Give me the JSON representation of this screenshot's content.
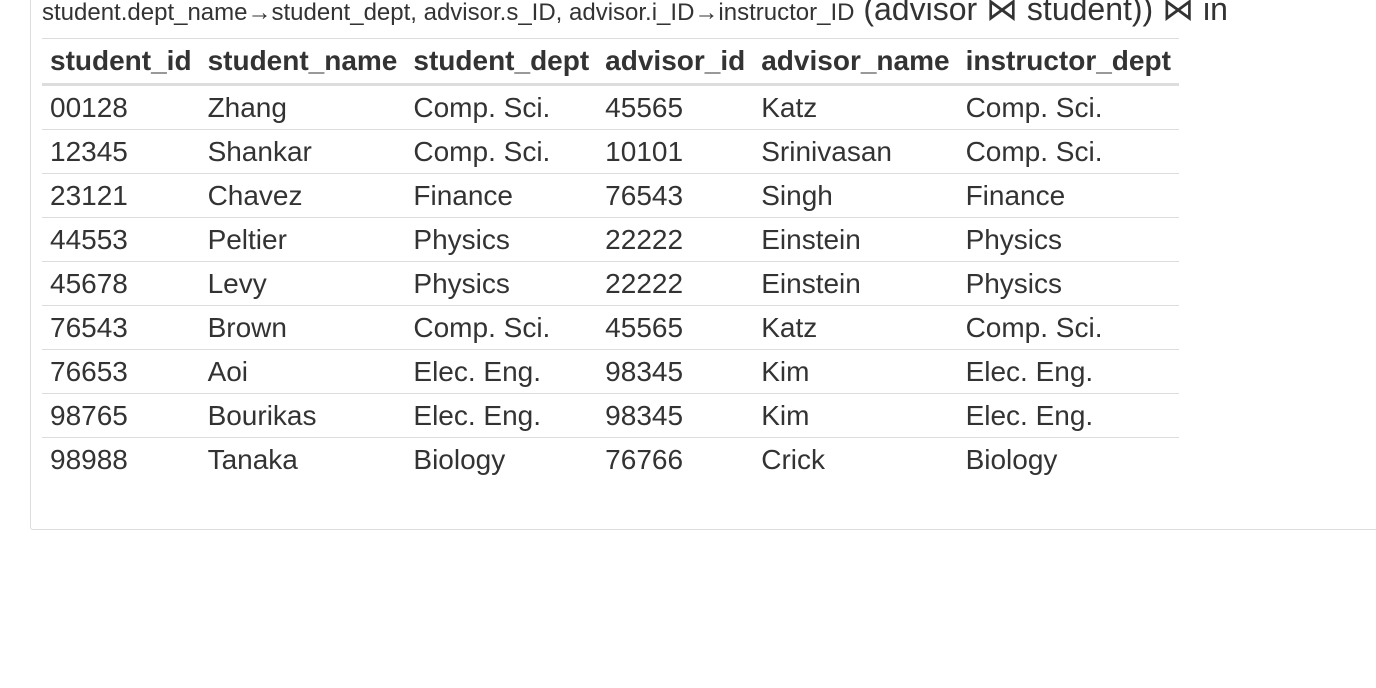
{
  "expression": {
    "prefix": "student.dept_name→student_dept, advisor.s_ID, advisor.i_ID→instructor_ID",
    "suffix": " (advisor ⋈ student)) ⋈ in"
  },
  "table": {
    "headers": [
      "student_id",
      "student_name",
      "student_dept",
      "advisor_id",
      "advisor_name",
      "instructor_dept"
    ],
    "rows": [
      [
        "00128",
        "Zhang",
        "Comp. Sci.",
        "45565",
        "Katz",
        "Comp. Sci."
      ],
      [
        "12345",
        "Shankar",
        "Comp. Sci.",
        "10101",
        "Srinivasan",
        "Comp. Sci."
      ],
      [
        "23121",
        "Chavez",
        "Finance",
        "76543",
        "Singh",
        "Finance"
      ],
      [
        "44553",
        "Peltier",
        "Physics",
        "22222",
        "Einstein",
        "Physics"
      ],
      [
        "45678",
        "Levy",
        "Physics",
        "22222",
        "Einstein",
        "Physics"
      ],
      [
        "76543",
        "Brown",
        "Comp. Sci.",
        "45565",
        "Katz",
        "Comp. Sci."
      ],
      [
        "76653",
        "Aoi",
        "Elec. Eng.",
        "98345",
        "Kim",
        "Elec. Eng."
      ],
      [
        "98765",
        "Bourikas",
        "Elec. Eng.",
        "98345",
        "Kim",
        "Elec. Eng."
      ],
      [
        "98988",
        "Tanaka",
        "Biology",
        "76766",
        "Crick",
        "Biology"
      ]
    ]
  }
}
